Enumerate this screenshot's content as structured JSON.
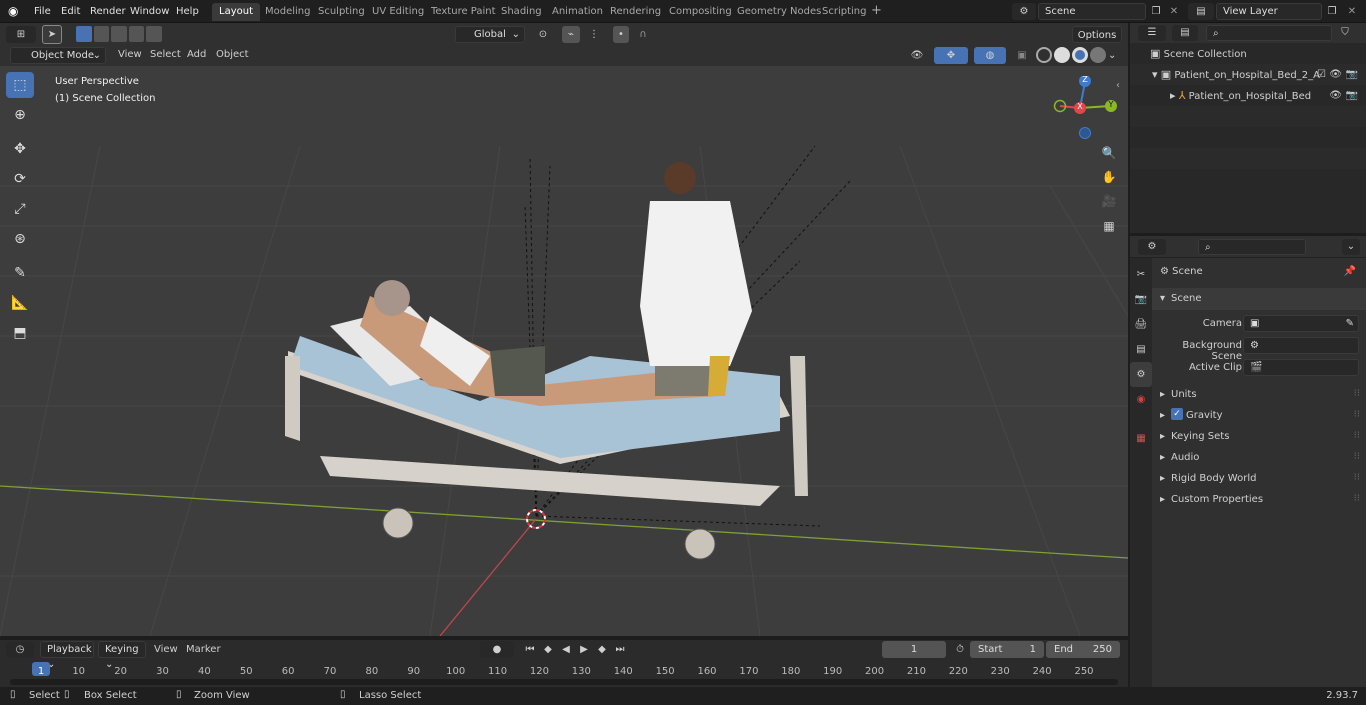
{
  "menus": [
    "File",
    "Edit",
    "Render",
    "Window",
    "Help"
  ],
  "workspaces": [
    "Layout",
    "Modeling",
    "Sculpting",
    "UV Editing",
    "Texture Paint",
    "Shading",
    "Animation",
    "Rendering",
    "Compositing",
    "Geometry Nodes",
    "Scripting"
  ],
  "scene_name": "Scene",
  "view_layer": "View Layer",
  "header": {
    "mode": "Object Mode",
    "view": "View",
    "select": "Select",
    "add": "Add",
    "object": "Object",
    "orientation": "Global",
    "options": "Options"
  },
  "viewport": {
    "perspective": "User Perspective",
    "collection": "(1) Scene Collection"
  },
  "gizmo": {
    "x": "X",
    "y": "Y",
    "z": "Z"
  },
  "outliner": {
    "root": "Scene Collection",
    "items": [
      "Patient_on_Hospital_Bed_2_A",
      "Patient_on_Hospital_Bed"
    ]
  },
  "properties": {
    "title": "Scene",
    "panel": "Scene",
    "camera": "Camera",
    "bg_scene": "Background Scene",
    "active_clip": "Active Clip",
    "sections": [
      "Units",
      "Gravity",
      "Keying Sets",
      "Audio",
      "Rigid Body World",
      "Custom Properties"
    ]
  },
  "timeline": {
    "playback": "Playback",
    "keying": "Keying",
    "view": "View",
    "marker": "Marker",
    "current": "1",
    "start_label": "Start",
    "start": "1",
    "end_label": "End",
    "end": "250",
    "ticks": [
      "1",
      "10",
      "20",
      "30",
      "40",
      "50",
      "60",
      "70",
      "80",
      "90",
      "100",
      "110",
      "120",
      "130",
      "140",
      "150",
      "160",
      "170",
      "180",
      "190",
      "200",
      "210",
      "220",
      "230",
      "240",
      "250"
    ]
  },
  "status": {
    "select": "Select",
    "box": "Box Select",
    "zoom": "Zoom View",
    "lasso": "Lasso Select",
    "version": "2.93.7"
  },
  "colors": {
    "accent": "#4772b3",
    "x_axis": "#e0474d",
    "y_axis": "#8bb925",
    "z_axis": "#3d7bd1"
  }
}
